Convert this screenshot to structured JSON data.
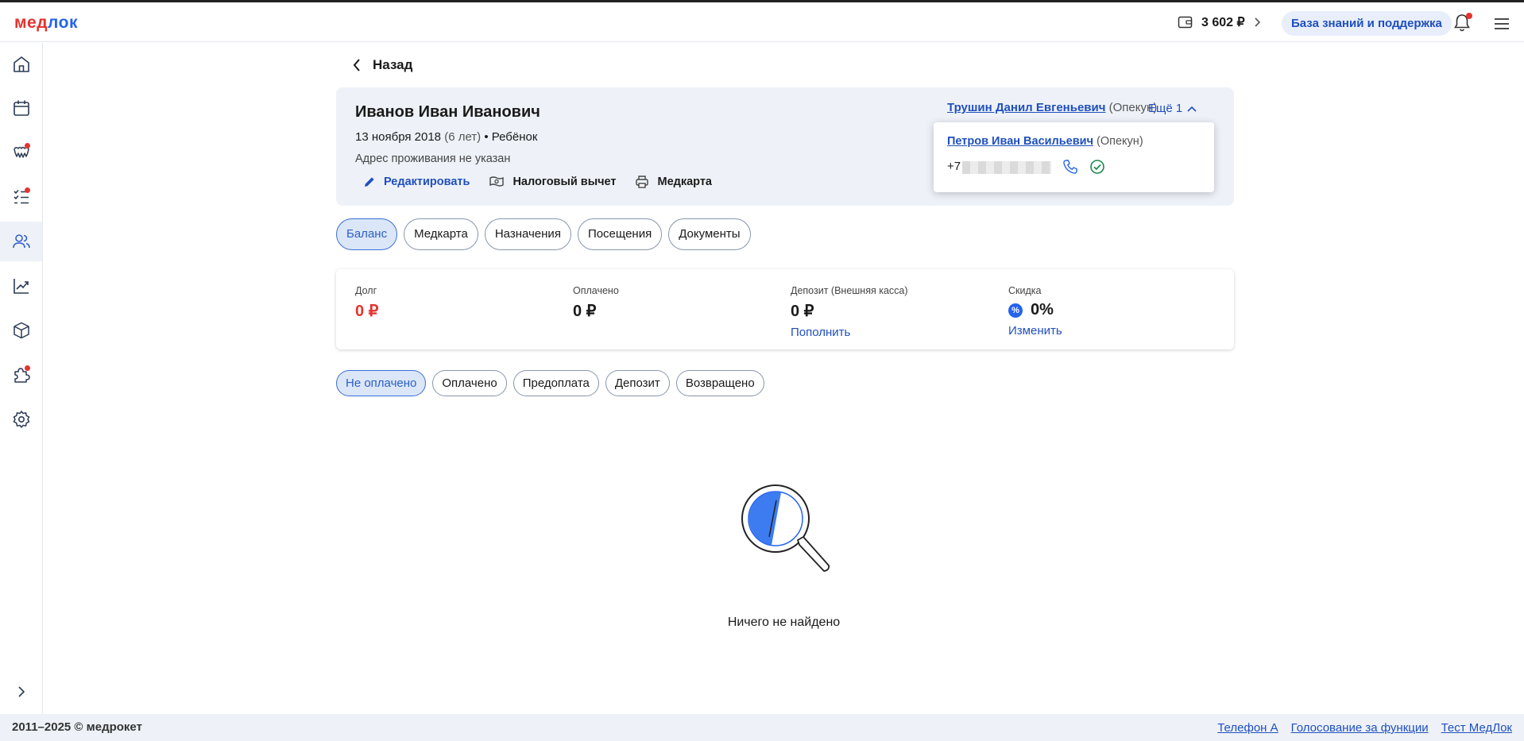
{
  "header": {
    "logo_part1": "мед",
    "logo_part2": "лок",
    "balance": "3 602 ₽",
    "kb_label": "База знаний и поддержка"
  },
  "back_label": "Назад",
  "patient": {
    "name": "Иванов Иван Иванович",
    "birth": "13 ноября 2018",
    "age": "(6 лет)",
    "role": "• Ребёнок",
    "address": "Адрес проживания не указан",
    "actions": {
      "edit": "Редактировать",
      "tax": "Налоговый вычет",
      "card": "Медкарта"
    },
    "guardian1_name": "Трушин Данил Евгеньевич",
    "guardian1_role": "(Опекун)",
    "more": "Ещё 1",
    "guardian2_name": "Петров Иван Васильевич",
    "guardian2_role": "(Опекун)",
    "phone_prefix": "+7"
  },
  "tabs": [
    "Баланс",
    "Медкарта",
    "Назначения",
    "Посещения",
    "Документы"
  ],
  "stats": {
    "debt_label": "Долг",
    "debt_value": "0 ₽",
    "paid_label": "Оплачено",
    "paid_value": "0 ₽",
    "deposit_label": "Депозит (Внешняя касса)",
    "deposit_value": "0 ₽",
    "deposit_link": "Пополнить",
    "discount_label": "Скидка",
    "discount_value": "0%",
    "discount_link": "Изменить"
  },
  "filters": [
    "Не оплачено",
    "Оплачено",
    "Предоплата",
    "Депозит",
    "Возвращено"
  ],
  "empty_text": "Ничего не найдено",
  "footer": {
    "copyright": "2011–2025 © медрокет",
    "links": [
      "Телефон А",
      "Голосование за функции",
      "Тест МедЛок"
    ]
  },
  "colors": {
    "accent": "#2563eb",
    "logo_red": "#e3342f",
    "active_pill_bg": "#dbe6f8"
  }
}
